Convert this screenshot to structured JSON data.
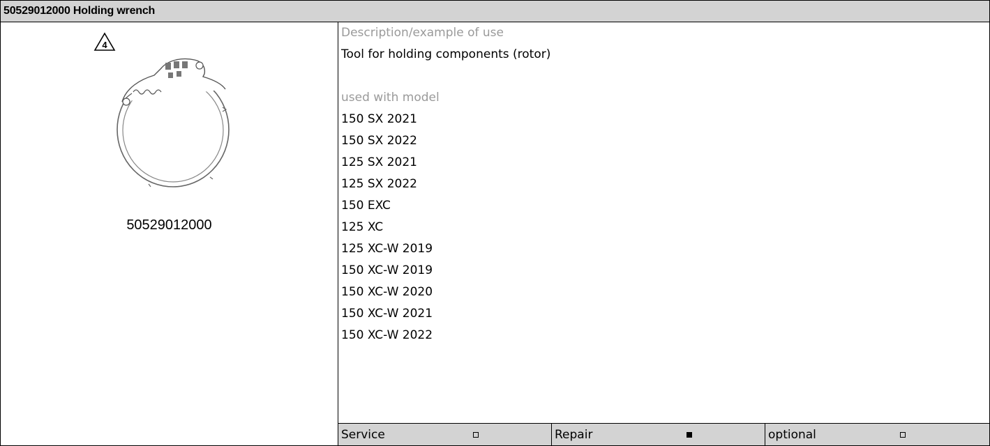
{
  "title": "50529012000 Holding wrench",
  "left": {
    "warning_number": "4",
    "image_icon": "holding-wrench-ring-image",
    "part_number": "50529012000"
  },
  "description": {
    "heading": "Description/example of use",
    "text": "Tool for holding components (rotor)"
  },
  "models": {
    "heading": "used with model",
    "items": [
      "150 SX 2021",
      "150 SX 2022",
      "125 SX 2021",
      "125 SX 2022",
      "150 EXC",
      "125 XC",
      "125 XC-W 2019",
      "150 XC-W 2019",
      "150 XC-W 2020",
      "150 XC-W 2021",
      "150 XC-W 2022"
    ]
  },
  "footer": {
    "cells": [
      {
        "label": "Service",
        "checked": false
      },
      {
        "label": "Repair",
        "checked": true
      },
      {
        "label": "optional",
        "checked": false
      }
    ]
  }
}
